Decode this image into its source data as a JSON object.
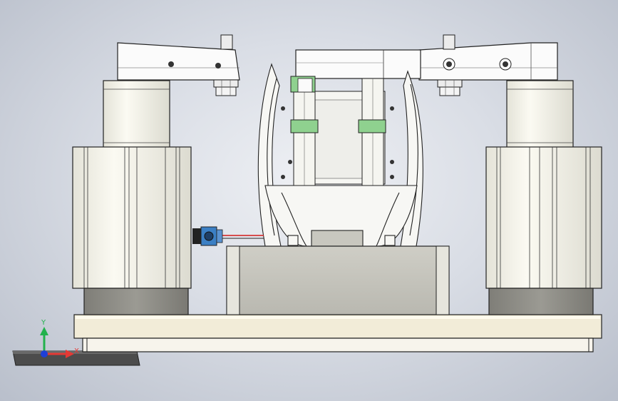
{
  "viewport": {
    "background": "#d4d8e0",
    "part_colors": {
      "cylinder_body": "#f7f6ec",
      "cylinder_shade": "#d9d8cc",
      "cylinder_base": "#8e8d86",
      "base_plate": "#f2ecd8",
      "center_block": "#c2c1b9",
      "accent_green": "#8fd18f",
      "sensor_blue": "#3b7fc4",
      "wire_red": "#d11a1a",
      "edge": "#222222"
    }
  },
  "triad": {
    "y_axis_label": "Y",
    "x_axis_label": "X",
    "y_color": "#22b14c",
    "x_color": "#e53935",
    "z_color": "#1e3fd6"
  }
}
